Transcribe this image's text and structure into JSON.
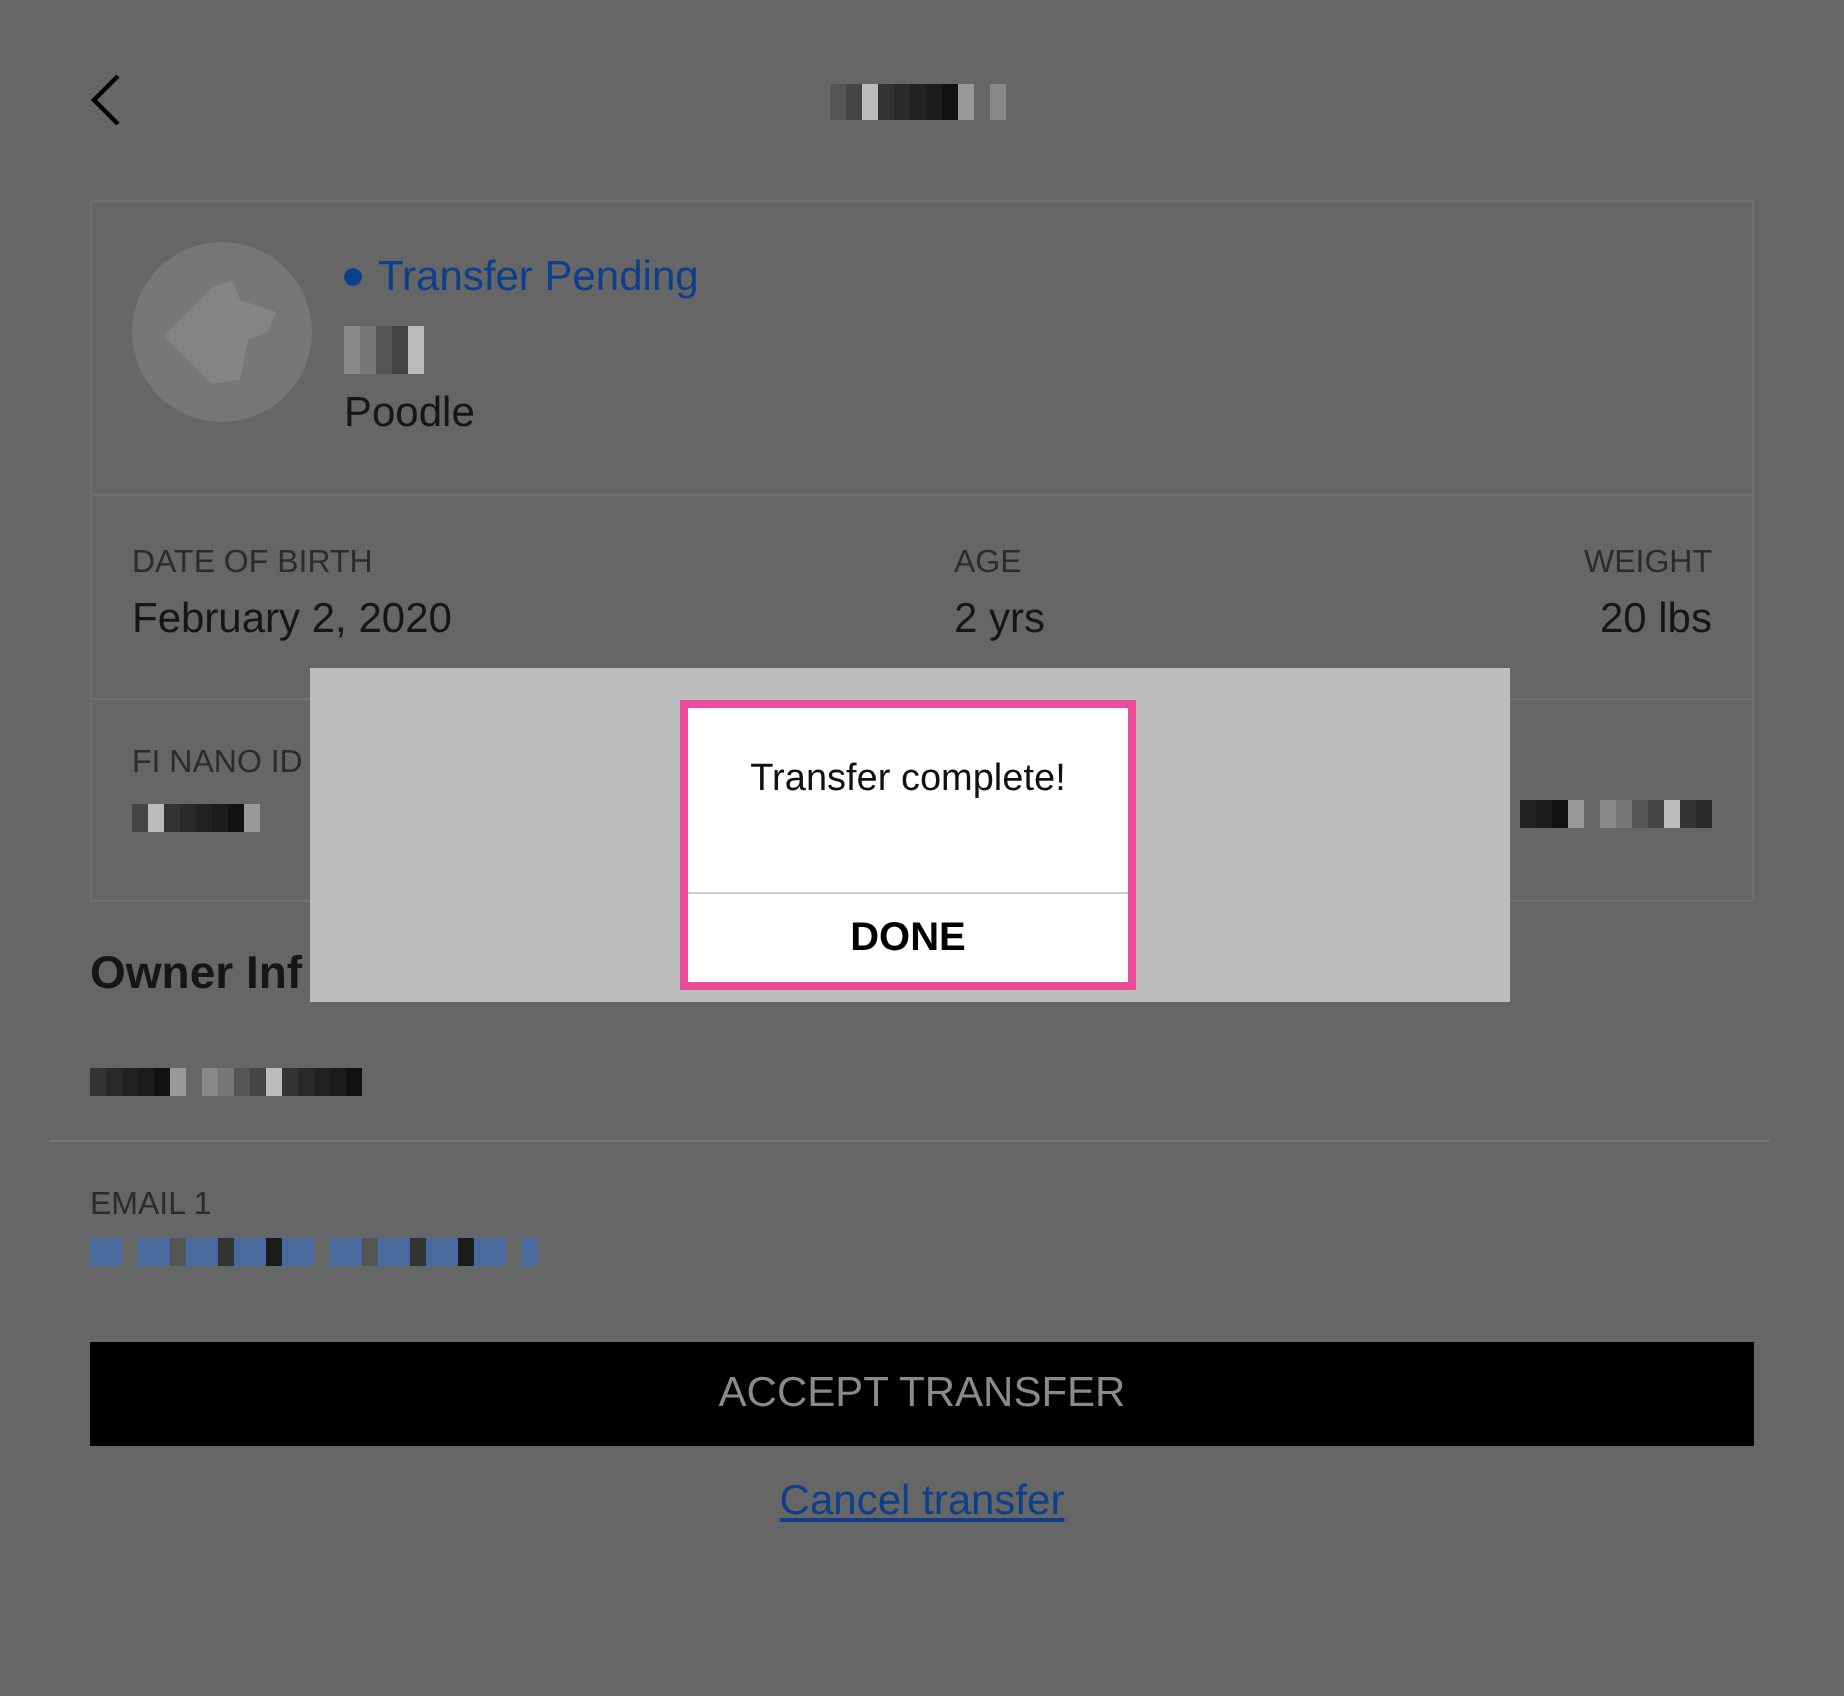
{
  "pet": {
    "status": "Transfer Pending",
    "breed": "Poodle"
  },
  "details": [
    {
      "label": "DATE OF BIRTH",
      "value": "February 2, 2020"
    },
    {
      "label": "AGE",
      "value": "2 yrs"
    },
    {
      "label": "WEIGHT",
      "value": "20 lbs"
    }
  ],
  "device": {
    "label": "FI NANO ID"
  },
  "owner": {
    "heading": "Owner Inf",
    "email_label": "EMAIL 1"
  },
  "accept_button": "ACCEPT TRANSFER",
  "cancel_link": "Cancel transfer",
  "dialog": {
    "message": "Transfer complete!",
    "button": "DONE"
  }
}
